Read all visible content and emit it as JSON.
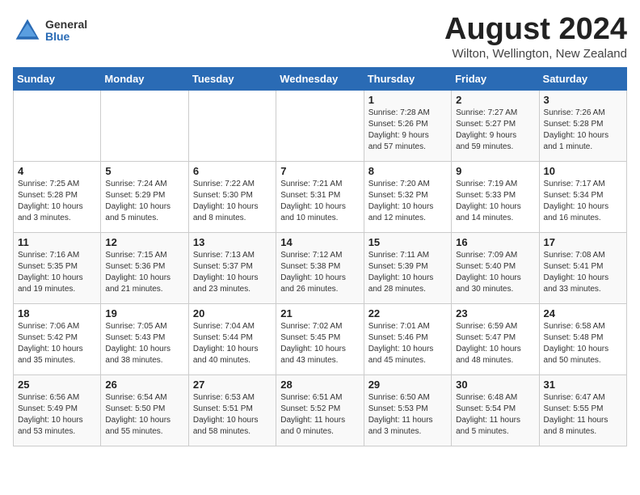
{
  "header": {
    "logo_general": "General",
    "logo_blue": "Blue",
    "month_year": "August 2024",
    "location": "Wilton, Wellington, New Zealand"
  },
  "days_of_week": [
    "Sunday",
    "Monday",
    "Tuesday",
    "Wednesday",
    "Thursday",
    "Friday",
    "Saturday"
  ],
  "weeks": [
    [
      {
        "day": "",
        "info": ""
      },
      {
        "day": "",
        "info": ""
      },
      {
        "day": "",
        "info": ""
      },
      {
        "day": "",
        "info": ""
      },
      {
        "day": "1",
        "info": "Sunrise: 7:28 AM\nSunset: 5:26 PM\nDaylight: 9 hours\nand 57 minutes."
      },
      {
        "day": "2",
        "info": "Sunrise: 7:27 AM\nSunset: 5:27 PM\nDaylight: 9 hours\nand 59 minutes."
      },
      {
        "day": "3",
        "info": "Sunrise: 7:26 AM\nSunset: 5:28 PM\nDaylight: 10 hours\nand 1 minute."
      }
    ],
    [
      {
        "day": "4",
        "info": "Sunrise: 7:25 AM\nSunset: 5:28 PM\nDaylight: 10 hours\nand 3 minutes."
      },
      {
        "day": "5",
        "info": "Sunrise: 7:24 AM\nSunset: 5:29 PM\nDaylight: 10 hours\nand 5 minutes."
      },
      {
        "day": "6",
        "info": "Sunrise: 7:22 AM\nSunset: 5:30 PM\nDaylight: 10 hours\nand 8 minutes."
      },
      {
        "day": "7",
        "info": "Sunrise: 7:21 AM\nSunset: 5:31 PM\nDaylight: 10 hours\nand 10 minutes."
      },
      {
        "day": "8",
        "info": "Sunrise: 7:20 AM\nSunset: 5:32 PM\nDaylight: 10 hours\nand 12 minutes."
      },
      {
        "day": "9",
        "info": "Sunrise: 7:19 AM\nSunset: 5:33 PM\nDaylight: 10 hours\nand 14 minutes."
      },
      {
        "day": "10",
        "info": "Sunrise: 7:17 AM\nSunset: 5:34 PM\nDaylight: 10 hours\nand 16 minutes."
      }
    ],
    [
      {
        "day": "11",
        "info": "Sunrise: 7:16 AM\nSunset: 5:35 PM\nDaylight: 10 hours\nand 19 minutes."
      },
      {
        "day": "12",
        "info": "Sunrise: 7:15 AM\nSunset: 5:36 PM\nDaylight: 10 hours\nand 21 minutes."
      },
      {
        "day": "13",
        "info": "Sunrise: 7:13 AM\nSunset: 5:37 PM\nDaylight: 10 hours\nand 23 minutes."
      },
      {
        "day": "14",
        "info": "Sunrise: 7:12 AM\nSunset: 5:38 PM\nDaylight: 10 hours\nand 26 minutes."
      },
      {
        "day": "15",
        "info": "Sunrise: 7:11 AM\nSunset: 5:39 PM\nDaylight: 10 hours\nand 28 minutes."
      },
      {
        "day": "16",
        "info": "Sunrise: 7:09 AM\nSunset: 5:40 PM\nDaylight: 10 hours\nand 30 minutes."
      },
      {
        "day": "17",
        "info": "Sunrise: 7:08 AM\nSunset: 5:41 PM\nDaylight: 10 hours\nand 33 minutes."
      }
    ],
    [
      {
        "day": "18",
        "info": "Sunrise: 7:06 AM\nSunset: 5:42 PM\nDaylight: 10 hours\nand 35 minutes."
      },
      {
        "day": "19",
        "info": "Sunrise: 7:05 AM\nSunset: 5:43 PM\nDaylight: 10 hours\nand 38 minutes."
      },
      {
        "day": "20",
        "info": "Sunrise: 7:04 AM\nSunset: 5:44 PM\nDaylight: 10 hours\nand 40 minutes."
      },
      {
        "day": "21",
        "info": "Sunrise: 7:02 AM\nSunset: 5:45 PM\nDaylight: 10 hours\nand 43 minutes."
      },
      {
        "day": "22",
        "info": "Sunrise: 7:01 AM\nSunset: 5:46 PM\nDaylight: 10 hours\nand 45 minutes."
      },
      {
        "day": "23",
        "info": "Sunrise: 6:59 AM\nSunset: 5:47 PM\nDaylight: 10 hours\nand 48 minutes."
      },
      {
        "day": "24",
        "info": "Sunrise: 6:58 AM\nSunset: 5:48 PM\nDaylight: 10 hours\nand 50 minutes."
      }
    ],
    [
      {
        "day": "25",
        "info": "Sunrise: 6:56 AM\nSunset: 5:49 PM\nDaylight: 10 hours\nand 53 minutes."
      },
      {
        "day": "26",
        "info": "Sunrise: 6:54 AM\nSunset: 5:50 PM\nDaylight: 10 hours\nand 55 minutes."
      },
      {
        "day": "27",
        "info": "Sunrise: 6:53 AM\nSunset: 5:51 PM\nDaylight: 10 hours\nand 58 minutes."
      },
      {
        "day": "28",
        "info": "Sunrise: 6:51 AM\nSunset: 5:52 PM\nDaylight: 11 hours\nand 0 minutes."
      },
      {
        "day": "29",
        "info": "Sunrise: 6:50 AM\nSunset: 5:53 PM\nDaylight: 11 hours\nand 3 minutes."
      },
      {
        "day": "30",
        "info": "Sunrise: 6:48 AM\nSunset: 5:54 PM\nDaylight: 11 hours\nand 5 minutes."
      },
      {
        "day": "31",
        "info": "Sunrise: 6:47 AM\nSunset: 5:55 PM\nDaylight: 11 hours\nand 8 minutes."
      }
    ]
  ]
}
